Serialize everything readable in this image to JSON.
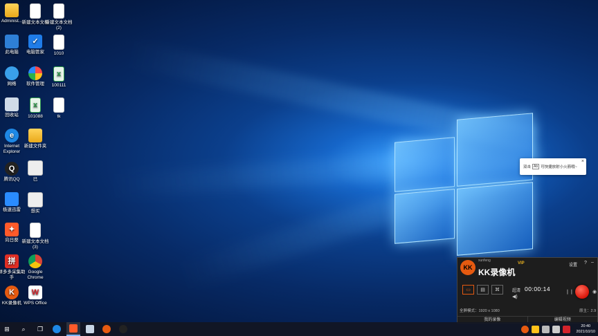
{
  "desktop": {
    "icons": [
      {
        "label": "Administ...",
        "icon": "folder-icon"
      },
      {
        "label": "新建文本文档",
        "icon": "text-document-icon"
      },
      {
        "label": "新建文本文档 (2)",
        "icon": "text-document-icon"
      },
      {
        "label": "此电脑",
        "icon": "computer-icon"
      },
      {
        "label": "电脑管家",
        "icon": "pc-manager-icon"
      },
      {
        "label": "1010",
        "icon": "text-document-icon"
      },
      {
        "label": "网络",
        "icon": "network-icon"
      },
      {
        "label": "软件管理",
        "icon": "software-manager-icon"
      },
      {
        "label": "100111",
        "icon": "excel-document-icon"
      },
      {
        "label": "回收站",
        "icon": "recycle-bin-icon"
      },
      {
        "label": "101088",
        "icon": "excel-document-icon"
      },
      {
        "label": "tk",
        "icon": "text-document-icon"
      },
      {
        "label": "Internet Explorer",
        "icon": "internet-explorer-icon"
      },
      {
        "label": "新建文件夹",
        "icon": "folder-icon"
      },
      {
        "label": "腾讯QQ",
        "icon": "qq-icon"
      },
      {
        "label": "已",
        "icon": "image-file-icon"
      },
      {
        "label": "极速迅雷",
        "icon": "xunlei-icon"
      },
      {
        "label": "想买",
        "icon": "image-file-icon"
      },
      {
        "label": "向日葵",
        "icon": "sunlogin-icon"
      },
      {
        "label": "新建文本文档 (3)",
        "icon": "text-document-icon"
      },
      {
        "label": "拼多多采集助手",
        "icon": "pinduoduo-icon"
      },
      {
        "label": "Google Chrome",
        "icon": "chrome-icon"
      },
      {
        "label": "KK录像机",
        "icon": "kk-recorder-icon"
      },
      {
        "label": "WPS Office",
        "icon": "wps-office-icon"
      }
    ]
  },
  "notification": {
    "prefix": "双击",
    "key": "Ab",
    "text": "可快捷放射小火箭哦~",
    "close": "×"
  },
  "kk": {
    "brand": "xunfeng",
    "logo": "KK",
    "title": "KK录像机",
    "vip": "VIP",
    "settings": "设置",
    "help": "?",
    "minimize": "–",
    "quality": "超清",
    "timer": "00:00:14",
    "info": "全屏模式：1920 x 1080",
    "source": "原主：2.9",
    "tab_mine": "我的录像",
    "tab_edit": "编辑视频"
  },
  "taskbar": {
    "start": "⊞",
    "search": "⌕",
    "task_view": "❐",
    "time": "20:40",
    "date": "2021/10/10"
  },
  "colors": {
    "accent": "#e65a10",
    "record": "#d8160a",
    "vip": "#e8b020"
  }
}
